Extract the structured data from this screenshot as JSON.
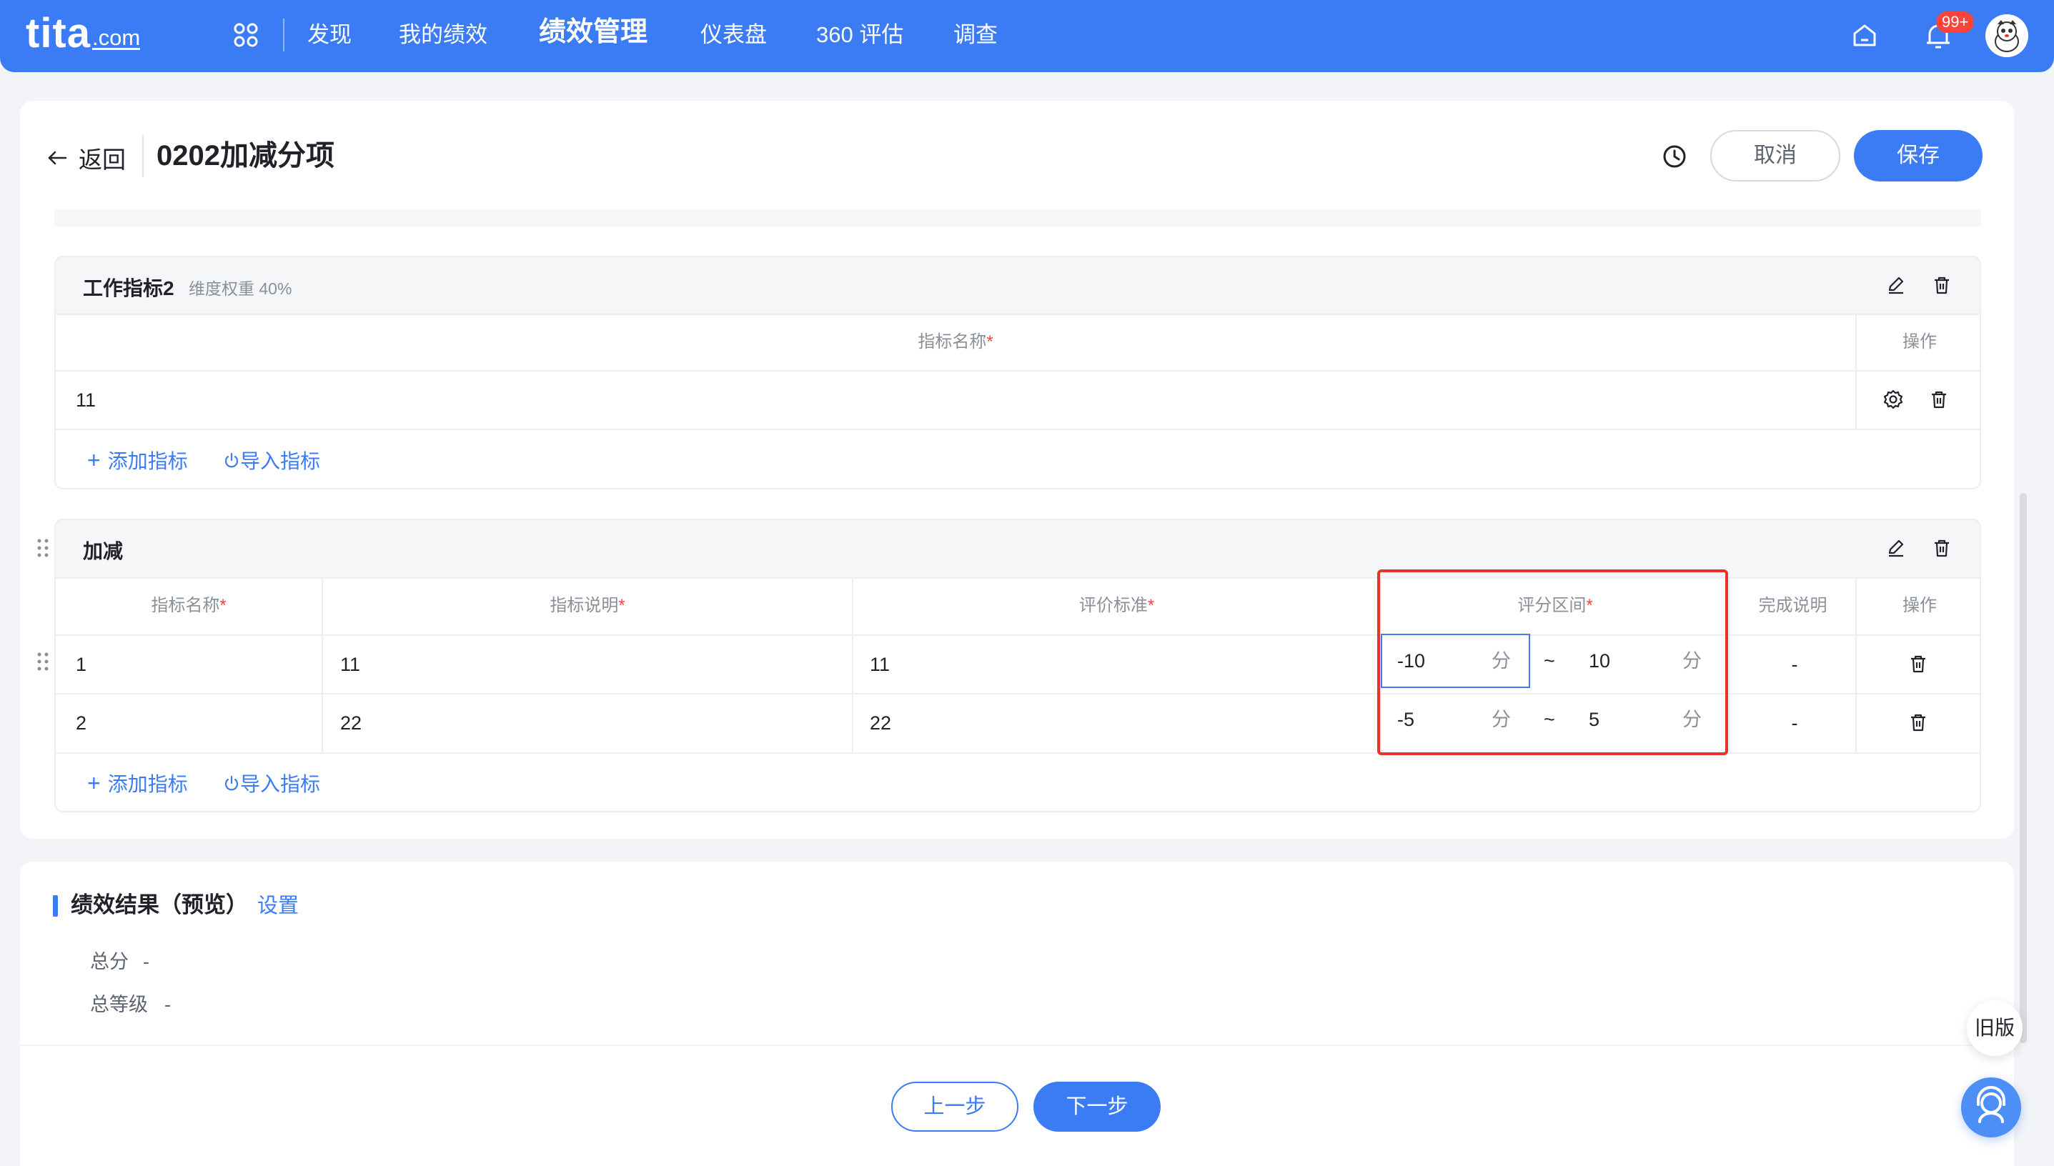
{
  "brand": {
    "logo_main": "tita",
    "logo_domain": ".com"
  },
  "nav": {
    "items": [
      "发现",
      "我的绩效",
      "绩效管理",
      "仪表盘",
      "360 评估",
      "调查"
    ],
    "badge": "99+"
  },
  "header": {
    "back_label": "返回",
    "title": "0202加减分项",
    "cancel_label": "取消",
    "save_label": "保存"
  },
  "section1": {
    "title": "工作指标2",
    "subtitle": "维度权重 40%",
    "col_name": "指标名称",
    "col_ops": "操作",
    "rows": [
      {
        "name": "11"
      }
    ],
    "add_label": "添加指标",
    "import_label": "导入指标"
  },
  "section2": {
    "title": "加减",
    "columns": {
      "name": "指标名称",
      "desc": "指标说明",
      "criteria": "评价标准",
      "range": "评分区间",
      "completion": "完成说明",
      "ops": "操作"
    },
    "rows": [
      {
        "name": "1",
        "desc": "11",
        "criteria": "11",
        "min": "-10",
        "max": "10",
        "unit": "分",
        "tilde": "~",
        "completion": "-"
      },
      {
        "name": "2",
        "desc": "22",
        "criteria": "22",
        "min": "-5",
        "max": "5",
        "unit": "分",
        "tilde": "~",
        "completion": "-"
      }
    ],
    "add_label": "添加指标",
    "import_label": "导入指标"
  },
  "result": {
    "title": "绩效结果（预览）",
    "settings_link": "设置",
    "total_score_label": "总分",
    "total_score_value": "-",
    "total_grade_label": "总等级",
    "total_grade_value": "-"
  },
  "footer": {
    "prev_label": "上一步",
    "next_label": "下一步"
  },
  "float": {
    "old_version": "旧版"
  },
  "colors": {
    "primary": "#3b7cf4",
    "danger": "#e8332a"
  }
}
